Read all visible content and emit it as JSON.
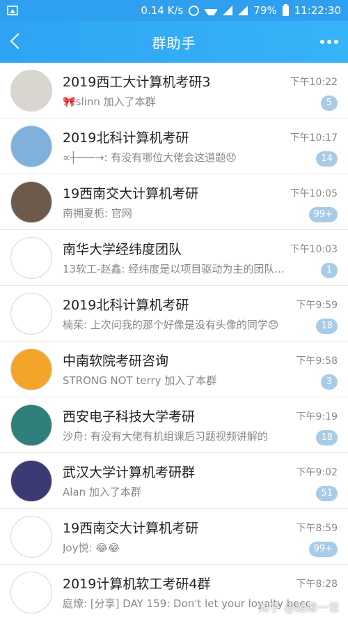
{
  "statusbar": {
    "speed": "0.14 K/s",
    "battery": "79%",
    "time": "11:22:30"
  },
  "header": {
    "title": "群助手"
  },
  "chats": [
    {
      "name": "2019西工大计算机考研3",
      "time": "下午10:22",
      "message": "🎀slinn 加入了本群",
      "badge": "5",
      "avatar_color": "#d8d6cf"
    },
    {
      "name": "2019北科计算机考研",
      "time": "下午10:17",
      "message": "∝┼───→: 有没有哪位大佬会这道题😞",
      "badge": "14",
      "avatar_color": "#7fb1dc"
    },
    {
      "name": "19西南交大计算机考研",
      "time": "下午10:05",
      "message": "南拥夏栀: 官网",
      "badge": "99+",
      "avatar_color": "#6d5a4a"
    },
    {
      "name": "南华大学经纬度团队",
      "time": "下午10:03",
      "message": "13软工-赵鑫: 经纬度是以项目驱动为主的团队...",
      "badge": "1",
      "avatar_color": "#ffffff"
    },
    {
      "name": "2019北科计算机考研",
      "time": "下午9:59",
      "message": "楠茱: 上次问我的那个好像是没有头像的同学😞",
      "badge": "18",
      "avatar_color": "#ffffff"
    },
    {
      "name": "中南软院考研咨询",
      "time": "下午9:58",
      "message": "STRONG NOT terry 加入了本群",
      "badge": "3",
      "avatar_color": "#f3a52a"
    },
    {
      "name": "西安电子科技大学考研",
      "time": "下午9:19",
      "message": "沙舟: 有没有大佬有机组课后习题视频讲解的",
      "badge": "18",
      "avatar_color": "#2f7f7a"
    },
    {
      "name": "武汉大学计算机考研群",
      "time": "下午9:02",
      "message": "Alan 加入了本群",
      "badge": "51",
      "avatar_color": "#3c3a74"
    },
    {
      "name": "19西南交大计算机考研",
      "time": "下午8:59",
      "message": "Joy悦: 😂😂",
      "badge": "99+",
      "avatar_color": "#ffffff"
    },
    {
      "name": "2019计算机软工考研4群",
      "time": "下午8:28",
      "message": "庭燎: [分享] DAY 159: Don't let your loyalty become",
      "badge": "",
      "avatar_color": "#ffffff"
    }
  ],
  "watermark": "知乎 @随缘一世"
}
